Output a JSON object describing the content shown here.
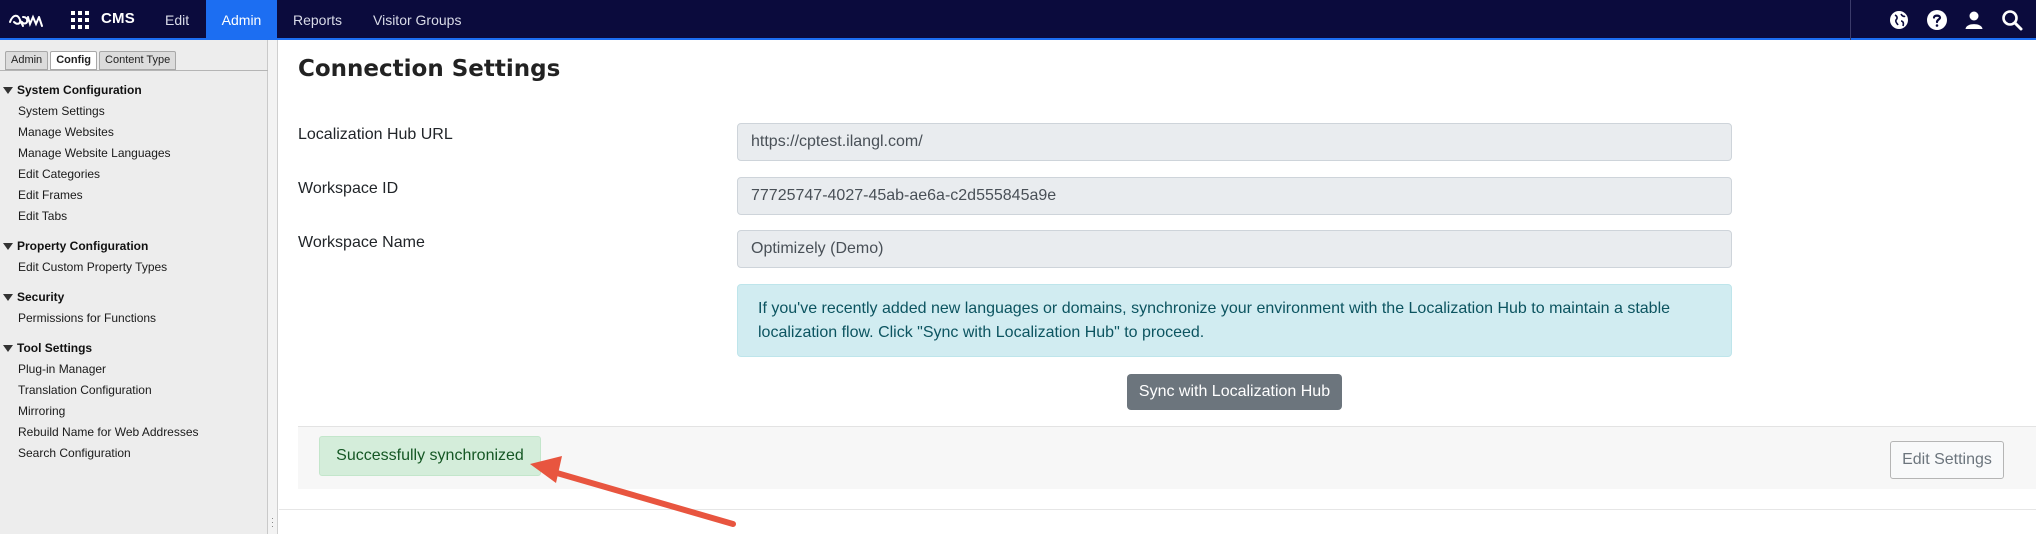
{
  "topbar": {
    "brand": "CMS",
    "nav": [
      {
        "label": "Edit"
      },
      {
        "label": "Admin"
      },
      {
        "label": "Reports"
      },
      {
        "label": "Visitor Groups"
      }
    ],
    "icons": [
      "globe-icon",
      "help-icon",
      "user-icon",
      "search-icon"
    ],
    "accent": "#1c6ef2",
    "background": "#0b0b3d"
  },
  "sidebar": {
    "tabs": [
      {
        "label": "Admin"
      },
      {
        "label": "Config"
      },
      {
        "label": "Content Type"
      }
    ],
    "groups": [
      {
        "title": "System Configuration",
        "items": [
          "System Settings",
          "Manage Websites",
          "Manage Website Languages",
          "Edit Categories",
          "Edit Frames",
          "Edit Tabs"
        ]
      },
      {
        "title": "Property Configuration",
        "items": [
          "Edit Custom Property Types"
        ]
      },
      {
        "title": "Security",
        "items": [
          "Permissions for Functions"
        ]
      },
      {
        "title": "Tool Settings",
        "items": [
          "Plug-in Manager",
          "Translation Configuration",
          "Mirroring",
          "Rebuild Name for Web Addresses",
          "Search Configuration"
        ]
      }
    ]
  },
  "main": {
    "title": "Connection Settings",
    "fields": [
      {
        "label": "Localization Hub URL",
        "value": "https://cptest.ilangl.com/"
      },
      {
        "label": "Workspace ID",
        "value": "77725747-4027-45ab-ae6a-c2d555845a9e"
      },
      {
        "label": "Workspace Name",
        "value": "Optimizely (Demo)"
      }
    ],
    "info_text": "If you've recently added new languages or domains, synchronize your environment with the Localization Hub to maintain a stable localization flow. Click \"Sync with Localization Hub\" to proceed.",
    "sync_button": "Sync with Localization Hub",
    "status_message": "Successfully synchronized",
    "edit_button": "Edit Settings"
  }
}
